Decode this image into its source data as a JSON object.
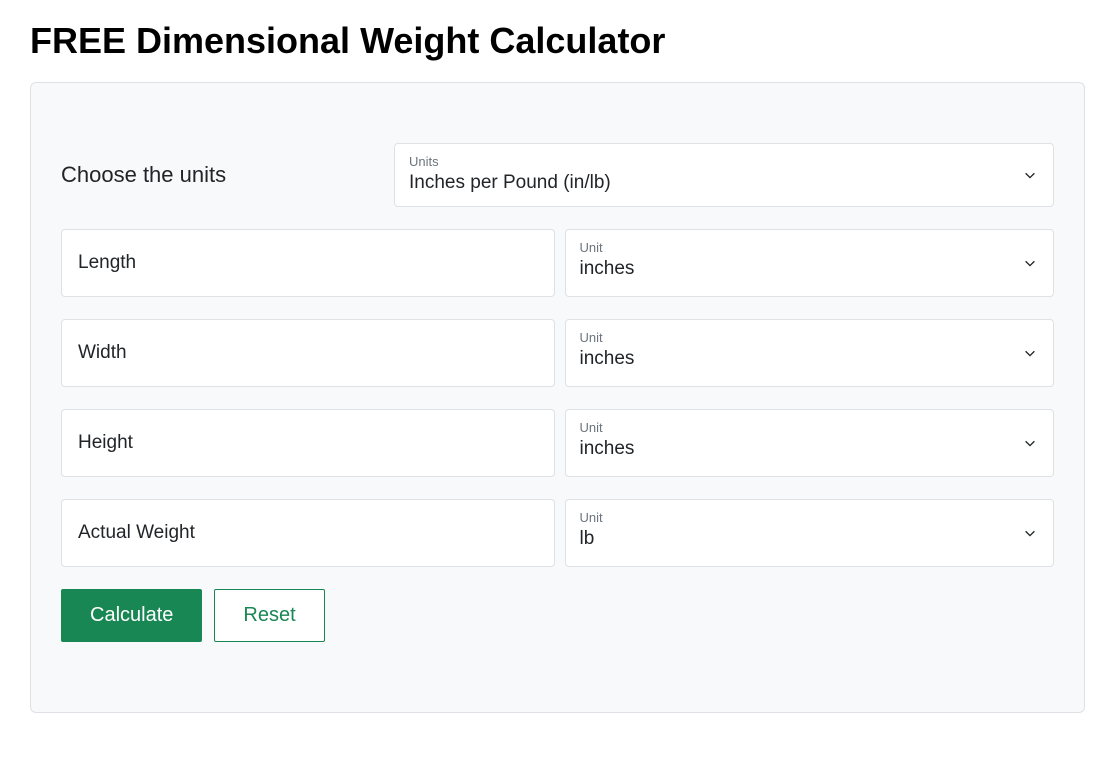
{
  "title": "FREE Dimensional Weight Calculator",
  "units_label": "Choose the units",
  "units_select": {
    "label": "Units",
    "value": "Inches per Pound (in/lb)"
  },
  "fields": {
    "length": {
      "placeholder": "Length",
      "unit_label": "Unit",
      "unit_value": "inches"
    },
    "width": {
      "placeholder": "Width",
      "unit_label": "Unit",
      "unit_value": "inches"
    },
    "height": {
      "placeholder": "Height",
      "unit_label": "Unit",
      "unit_value": "inches"
    },
    "weight": {
      "placeholder": "Actual Weight",
      "unit_label": "Unit",
      "unit_value": "lb"
    }
  },
  "buttons": {
    "calculate": "Calculate",
    "reset": "Reset"
  }
}
